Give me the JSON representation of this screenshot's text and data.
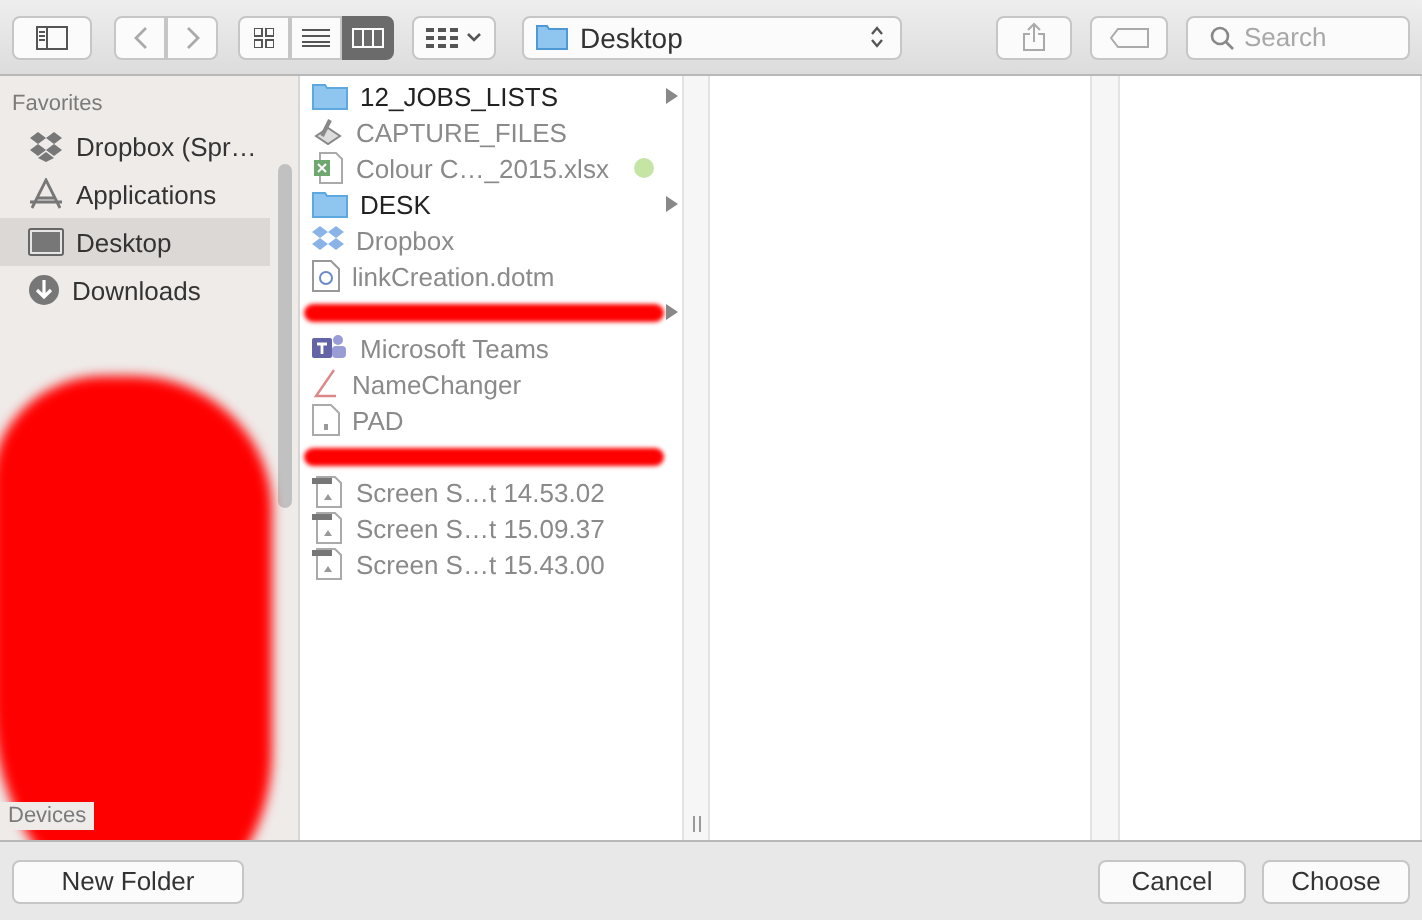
{
  "toolbar": {
    "view_modes": [
      {
        "kind": "icons",
        "selected": false
      },
      {
        "kind": "list",
        "selected": false
      },
      {
        "kind": "columns",
        "selected": true
      }
    ],
    "location": "Desktop",
    "search": {
      "placeholder": "Search"
    }
  },
  "sidebar": {
    "sections": [
      {
        "title": "Favorites",
        "items": [
          {
            "label": "Dropbox (Spr…",
            "kind": "dropbox",
            "selected": false
          },
          {
            "label": "Applications",
            "kind": "apps",
            "selected": false
          },
          {
            "label": "Desktop",
            "kind": "desktop",
            "selected": true
          },
          {
            "label": "Downloads",
            "kind": "downloads",
            "selected": false
          }
        ]
      },
      {
        "title": "Devices"
      }
    ]
  },
  "files": [
    {
      "kind": "folder",
      "name": "12_JOBS_LISTS",
      "disabled": false,
      "has_children": true
    },
    {
      "kind": "tool",
      "name": "CAPTURE_FILES",
      "disabled": true,
      "has_children": false
    },
    {
      "kind": "excel",
      "name": "Colour C…_2015.xlsx",
      "disabled": true,
      "has_children": false,
      "color": "#c6e4a4"
    },
    {
      "kind": "folder",
      "name": "DESK",
      "disabled": false,
      "has_children": true
    },
    {
      "kind": "dropbox",
      "name": "Dropbox",
      "disabled": true,
      "has_children": false
    },
    {
      "kind": "word",
      "name": "linkCreation.dotm",
      "disabled": true,
      "has_children": false
    },
    {
      "kind": "redacted",
      "has_children": true
    },
    {
      "kind": "teams",
      "name": "Microsoft Teams",
      "disabled": true,
      "has_children": false
    },
    {
      "kind": "app",
      "name": "NameChanger",
      "disabled": true,
      "has_children": false
    },
    {
      "kind": "doc",
      "name": "PAD",
      "disabled": true,
      "has_children": false
    },
    {
      "kind": "redacted",
      "has_children": false
    },
    {
      "kind": "screenshot",
      "name": "Screen S…t 14.53.02",
      "disabled": true,
      "has_children": false
    },
    {
      "kind": "screenshot",
      "name": "Screen S…t 15.09.37",
      "disabled": true,
      "has_children": false
    },
    {
      "kind": "screenshot",
      "name": "Screen S…t 15.43.00",
      "disabled": true,
      "has_children": false
    }
  ],
  "buttons": {
    "left": [
      "New Folder"
    ],
    "right": [
      "Cancel",
      "Choose"
    ]
  }
}
